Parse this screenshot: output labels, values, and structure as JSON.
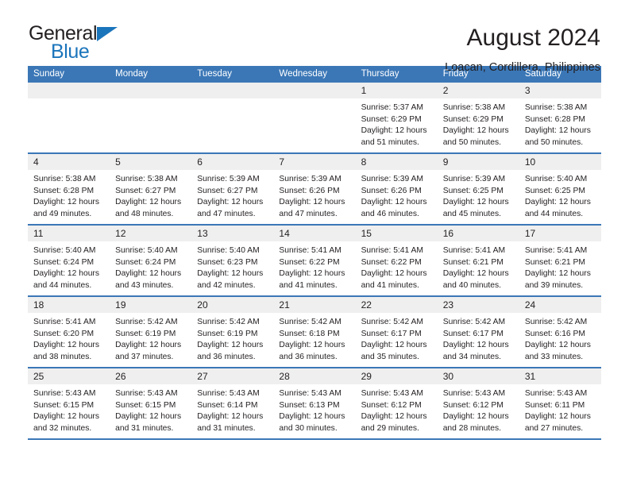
{
  "brand": {
    "name_top": "General",
    "name_bottom": "Blue",
    "triangle_color": "#1b75bb"
  },
  "header": {
    "title": "August 2024",
    "subtitle": "Loacan, Cordillera, Philippines"
  },
  "theme": {
    "header_blue": "#3b77b7",
    "daynum_band": "#efefef",
    "text": "#231f20"
  },
  "weekdays": [
    "Sunday",
    "Monday",
    "Tuesday",
    "Wednesday",
    "Thursday",
    "Friday",
    "Saturday"
  ],
  "weeks": [
    [
      {
        "day": "",
        "empty": true
      },
      {
        "day": "",
        "empty": true
      },
      {
        "day": "",
        "empty": true
      },
      {
        "day": "",
        "empty": true
      },
      {
        "day": "1",
        "sunrise": "Sunrise: 5:37 AM",
        "sunset": "Sunset: 6:29 PM",
        "daylight1": "Daylight: 12 hours",
        "daylight2": "and 51 minutes."
      },
      {
        "day": "2",
        "sunrise": "Sunrise: 5:38 AM",
        "sunset": "Sunset: 6:29 PM",
        "daylight1": "Daylight: 12 hours",
        "daylight2": "and 50 minutes."
      },
      {
        "day": "3",
        "sunrise": "Sunrise: 5:38 AM",
        "sunset": "Sunset: 6:28 PM",
        "daylight1": "Daylight: 12 hours",
        "daylight2": "and 50 minutes."
      }
    ],
    [
      {
        "day": "4",
        "sunrise": "Sunrise: 5:38 AM",
        "sunset": "Sunset: 6:28 PM",
        "daylight1": "Daylight: 12 hours",
        "daylight2": "and 49 minutes."
      },
      {
        "day": "5",
        "sunrise": "Sunrise: 5:38 AM",
        "sunset": "Sunset: 6:27 PM",
        "daylight1": "Daylight: 12 hours",
        "daylight2": "and 48 minutes."
      },
      {
        "day": "6",
        "sunrise": "Sunrise: 5:39 AM",
        "sunset": "Sunset: 6:27 PM",
        "daylight1": "Daylight: 12 hours",
        "daylight2": "and 47 minutes."
      },
      {
        "day": "7",
        "sunrise": "Sunrise: 5:39 AM",
        "sunset": "Sunset: 6:26 PM",
        "daylight1": "Daylight: 12 hours",
        "daylight2": "and 47 minutes."
      },
      {
        "day": "8",
        "sunrise": "Sunrise: 5:39 AM",
        "sunset": "Sunset: 6:26 PM",
        "daylight1": "Daylight: 12 hours",
        "daylight2": "and 46 minutes."
      },
      {
        "day": "9",
        "sunrise": "Sunrise: 5:39 AM",
        "sunset": "Sunset: 6:25 PM",
        "daylight1": "Daylight: 12 hours",
        "daylight2": "and 45 minutes."
      },
      {
        "day": "10",
        "sunrise": "Sunrise: 5:40 AM",
        "sunset": "Sunset: 6:25 PM",
        "daylight1": "Daylight: 12 hours",
        "daylight2": "and 44 minutes."
      }
    ],
    [
      {
        "day": "11",
        "sunrise": "Sunrise: 5:40 AM",
        "sunset": "Sunset: 6:24 PM",
        "daylight1": "Daylight: 12 hours",
        "daylight2": "and 44 minutes."
      },
      {
        "day": "12",
        "sunrise": "Sunrise: 5:40 AM",
        "sunset": "Sunset: 6:24 PM",
        "daylight1": "Daylight: 12 hours",
        "daylight2": "and 43 minutes."
      },
      {
        "day": "13",
        "sunrise": "Sunrise: 5:40 AM",
        "sunset": "Sunset: 6:23 PM",
        "daylight1": "Daylight: 12 hours",
        "daylight2": "and 42 minutes."
      },
      {
        "day": "14",
        "sunrise": "Sunrise: 5:41 AM",
        "sunset": "Sunset: 6:22 PM",
        "daylight1": "Daylight: 12 hours",
        "daylight2": "and 41 minutes."
      },
      {
        "day": "15",
        "sunrise": "Sunrise: 5:41 AM",
        "sunset": "Sunset: 6:22 PM",
        "daylight1": "Daylight: 12 hours",
        "daylight2": "and 41 minutes."
      },
      {
        "day": "16",
        "sunrise": "Sunrise: 5:41 AM",
        "sunset": "Sunset: 6:21 PM",
        "daylight1": "Daylight: 12 hours",
        "daylight2": "and 40 minutes."
      },
      {
        "day": "17",
        "sunrise": "Sunrise: 5:41 AM",
        "sunset": "Sunset: 6:21 PM",
        "daylight1": "Daylight: 12 hours",
        "daylight2": "and 39 minutes."
      }
    ],
    [
      {
        "day": "18",
        "sunrise": "Sunrise: 5:41 AM",
        "sunset": "Sunset: 6:20 PM",
        "daylight1": "Daylight: 12 hours",
        "daylight2": "and 38 minutes."
      },
      {
        "day": "19",
        "sunrise": "Sunrise: 5:42 AM",
        "sunset": "Sunset: 6:19 PM",
        "daylight1": "Daylight: 12 hours",
        "daylight2": "and 37 minutes."
      },
      {
        "day": "20",
        "sunrise": "Sunrise: 5:42 AM",
        "sunset": "Sunset: 6:19 PM",
        "daylight1": "Daylight: 12 hours",
        "daylight2": "and 36 minutes."
      },
      {
        "day": "21",
        "sunrise": "Sunrise: 5:42 AM",
        "sunset": "Sunset: 6:18 PM",
        "daylight1": "Daylight: 12 hours",
        "daylight2": "and 36 minutes."
      },
      {
        "day": "22",
        "sunrise": "Sunrise: 5:42 AM",
        "sunset": "Sunset: 6:17 PM",
        "daylight1": "Daylight: 12 hours",
        "daylight2": "and 35 minutes."
      },
      {
        "day": "23",
        "sunrise": "Sunrise: 5:42 AM",
        "sunset": "Sunset: 6:17 PM",
        "daylight1": "Daylight: 12 hours",
        "daylight2": "and 34 minutes."
      },
      {
        "day": "24",
        "sunrise": "Sunrise: 5:42 AM",
        "sunset": "Sunset: 6:16 PM",
        "daylight1": "Daylight: 12 hours",
        "daylight2": "and 33 minutes."
      }
    ],
    [
      {
        "day": "25",
        "sunrise": "Sunrise: 5:43 AM",
        "sunset": "Sunset: 6:15 PM",
        "daylight1": "Daylight: 12 hours",
        "daylight2": "and 32 minutes."
      },
      {
        "day": "26",
        "sunrise": "Sunrise: 5:43 AM",
        "sunset": "Sunset: 6:15 PM",
        "daylight1": "Daylight: 12 hours",
        "daylight2": "and 31 minutes."
      },
      {
        "day": "27",
        "sunrise": "Sunrise: 5:43 AM",
        "sunset": "Sunset: 6:14 PM",
        "daylight1": "Daylight: 12 hours",
        "daylight2": "and 31 minutes."
      },
      {
        "day": "28",
        "sunrise": "Sunrise: 5:43 AM",
        "sunset": "Sunset: 6:13 PM",
        "daylight1": "Daylight: 12 hours",
        "daylight2": "and 30 minutes."
      },
      {
        "day": "29",
        "sunrise": "Sunrise: 5:43 AM",
        "sunset": "Sunset: 6:12 PM",
        "daylight1": "Daylight: 12 hours",
        "daylight2": "and 29 minutes."
      },
      {
        "day": "30",
        "sunrise": "Sunrise: 5:43 AM",
        "sunset": "Sunset: 6:12 PM",
        "daylight1": "Daylight: 12 hours",
        "daylight2": "and 28 minutes."
      },
      {
        "day": "31",
        "sunrise": "Sunrise: 5:43 AM",
        "sunset": "Sunset: 6:11 PM",
        "daylight1": "Daylight: 12 hours",
        "daylight2": "and 27 minutes."
      }
    ]
  ]
}
